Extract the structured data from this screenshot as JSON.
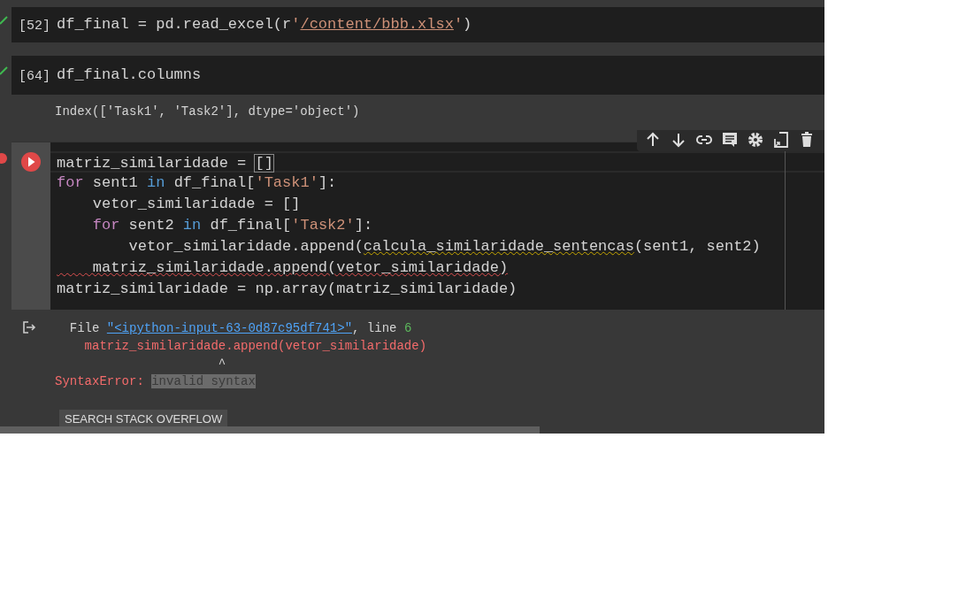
{
  "cells": [
    {
      "error": false,
      "count": "[52]",
      "selected": false,
      "lines": [
        [
          {
            "t": "df_final = pd.read_excel(r",
            "kind": "plain"
          },
          {
            "t": "'",
            "kind": "string"
          },
          {
            "t": "/content/bbb.xlsx",
            "kind": "path"
          },
          {
            "t": "'",
            "kind": "string"
          },
          {
            "t": ")",
            "kind": "plain"
          }
        ]
      ]
    },
    {
      "error": false,
      "count": "[64]",
      "selected": false,
      "lines": [
        [
          {
            "t": "df_final.columns",
            "kind": "plain"
          }
        ]
      ],
      "output": {
        "kind": "text",
        "lines": [
          [
            {
              "t": "Index(['Task1', 'Task2'], dtype='object')",
              "kind": "plain"
            }
          ]
        ]
      }
    },
    {
      "error": true,
      "selected": true,
      "show_toolbar": true,
      "lines": [
        [
          {
            "t": "matriz_similaridade = ",
            "kind": "plain"
          },
          {
            "t": "[]",
            "kind": "cursor"
          }
        ],
        [
          {
            "t": "for",
            "kind": "keyword"
          },
          {
            "t": " sent1 ",
            "kind": "plain"
          },
          {
            "t": "in",
            "kind": "operator"
          },
          {
            "t": " df_final[",
            "kind": "plain"
          },
          {
            "t": "'Task1'",
            "kind": "string"
          },
          {
            "t": "]:",
            "kind": "plain"
          }
        ],
        [
          {
            "t": "    vetor_similaridade = []",
            "kind": "plain"
          }
        ],
        [
          {
            "t": "    for",
            "kind": "keyword"
          },
          {
            "t": " sent2 ",
            "kind": "plain"
          },
          {
            "t": "in",
            "kind": "operator"
          },
          {
            "t": " df_final[",
            "kind": "plain"
          },
          {
            "t": "'Task2'",
            "kind": "string"
          },
          {
            "t": "]:",
            "kind": "plain"
          }
        ],
        [
          {
            "t": "        vetor_similaridade.append(",
            "kind": "plain"
          },
          {
            "t": "calcula_similaridade_sentencas",
            "kind": "warning"
          },
          {
            "t": "(sent1, sent2)",
            "kind": "plain"
          }
        ],
        [
          {
            "t": "    matriz_similaridade.append(vetor_similaridade)",
            "kind": "error"
          }
        ],
        [
          {
            "t": "matriz_similaridade = np.array(matriz_similaridade)",
            "kind": "plain"
          }
        ]
      ],
      "output": {
        "kind": "error",
        "lines": [
          [
            {
              "t": "  File ",
              "kind": "plain"
            },
            {
              "t": "\"<ipython-input-63-0d87c95df741>\"",
              "kind": "link"
            },
            {
              "t": ", line ",
              "kind": "plain"
            },
            {
              "t": "6",
              "kind": "number"
            }
          ],
          [
            {
              "t": "    matriz_similaridade.append(vetor_similaridade)",
              "kind": "err"
            }
          ],
          [
            {
              "t": "                      ^",
              "kind": "plain"
            }
          ],
          [
            {
              "t": "SyntaxError: ",
              "kind": "err"
            },
            {
              "t": "invalid syntax",
              "kind": "highlight"
            }
          ]
        ],
        "button": "SEARCH STACK OVERFLOW"
      }
    }
  ]
}
